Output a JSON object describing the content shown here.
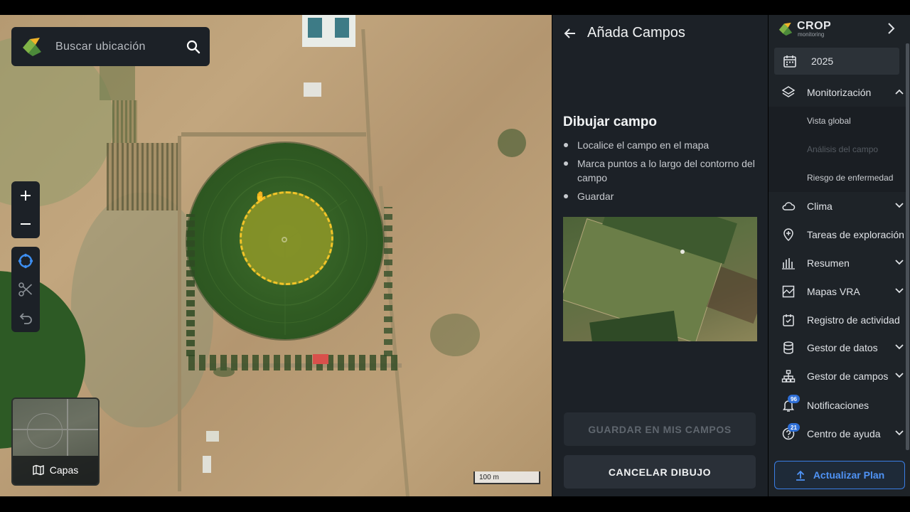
{
  "search": {
    "placeholder": "Buscar ubicación"
  },
  "map": {
    "layers_label": "Capas",
    "scale_label": "100 m",
    "accent_dashed": "#f2c428"
  },
  "panel": {
    "title": "Añada Campos",
    "section_title": "Dibujar campo",
    "steps": [
      "Localice el campo en el mapa",
      "Marca puntos a lo largo del contorno del campo",
      "Guardar"
    ],
    "save_label": "GUARDAR EN MIS CAMPOS",
    "cancel_label": "CANCELAR DIBUJO"
  },
  "sidebar": {
    "brand": "CROP",
    "brand_sub": "monitoring",
    "year": "2025",
    "items": [
      {
        "label": "Monitorización",
        "icon": "layers-icon",
        "expanded": true
      },
      {
        "label": "Clima",
        "icon": "cloud-icon"
      },
      {
        "label": "Tareas de exploración",
        "icon": "pin-plus-icon"
      },
      {
        "label": "Resumen",
        "icon": "bar-chart-icon"
      },
      {
        "label": "Mapas VRA",
        "icon": "vra-map-icon"
      },
      {
        "label": "Registro de actividad",
        "icon": "calendar-check-icon"
      },
      {
        "label": "Gestor de datos",
        "icon": "database-icon"
      },
      {
        "label": "Gestor de campos",
        "icon": "hierarchy-icon"
      },
      {
        "label": "Notificaciones",
        "icon": "bell-icon",
        "badge": "96"
      },
      {
        "label": "Centro de ayuda",
        "icon": "help-icon",
        "badge": "21"
      }
    ],
    "sub_items": [
      {
        "label": "Vista global",
        "disabled": false
      },
      {
        "label": "Análisis del campo",
        "disabled": true
      },
      {
        "label": "Riesgo de enfermedad",
        "disabled": false
      }
    ],
    "upgrade_label": "Actualizar Plan",
    "accent": "#4f93f5"
  }
}
